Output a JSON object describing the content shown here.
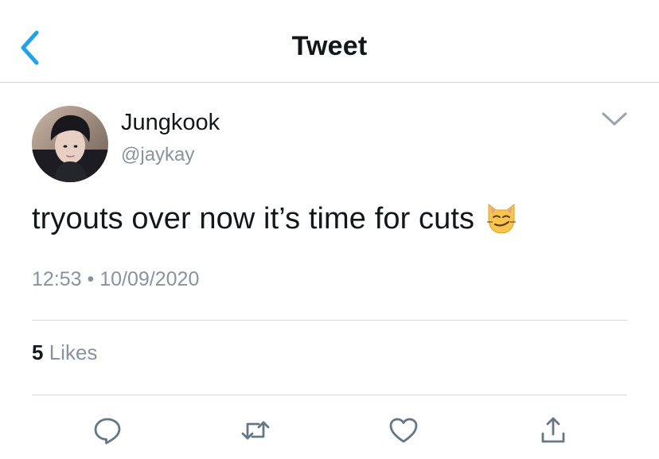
{
  "nav": {
    "title": "Tweet",
    "back_icon": "chevron-left-icon",
    "accent": "#1da1f2"
  },
  "author": {
    "name": "Jungkook",
    "handle": "@jaykay",
    "avatar": "profile-photo"
  },
  "tweet": {
    "text": "tryouts over now it’s time for cuts",
    "emoji": "smirking-cat-emoji",
    "time": "12:53",
    "separator": "•",
    "date": "10/09/2020",
    "likes_count": "5",
    "likes_label": "Likes"
  },
  "actions": [
    "reply-icon",
    "retweet-icon",
    "like-icon",
    "share-icon"
  ],
  "colors": {
    "text": "#14171a",
    "secondary": "#8a939b",
    "divider": "#d5d9dc",
    "icon": "#657786"
  }
}
